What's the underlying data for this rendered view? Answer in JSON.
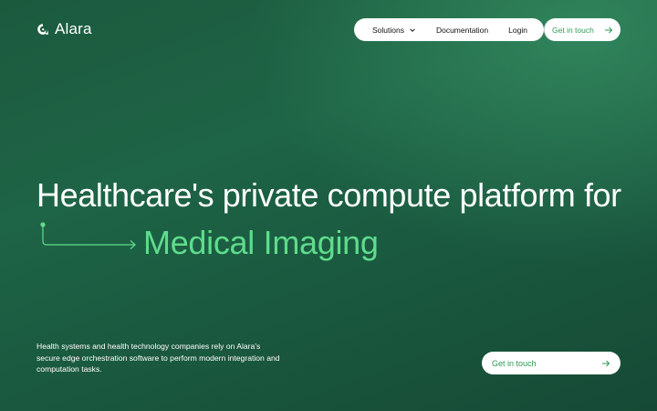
{
  "brand": {
    "name": "Alara"
  },
  "nav": {
    "items": [
      {
        "label": "Solutions",
        "has_dropdown": true
      },
      {
        "label": "Documentation"
      },
      {
        "label": "Login"
      }
    ],
    "cta": "Get in touch"
  },
  "hero": {
    "line1": "Healthcare's private compute platform for",
    "line2": "Medical Imaging",
    "description": "Health systems and health technology companies rely on Alara's secure edge orchestration software to perform modern integration and computation tasks.",
    "cta": "Get in touch"
  },
  "colors": {
    "accent": "#5fdc8c",
    "cta_text": "#2f9a57",
    "background": "#1c5a3e"
  },
  "icons": {
    "logo": "alara-logo-icon",
    "dropdown": "chevron-down-icon",
    "arrow": "arrow-right-icon"
  }
}
